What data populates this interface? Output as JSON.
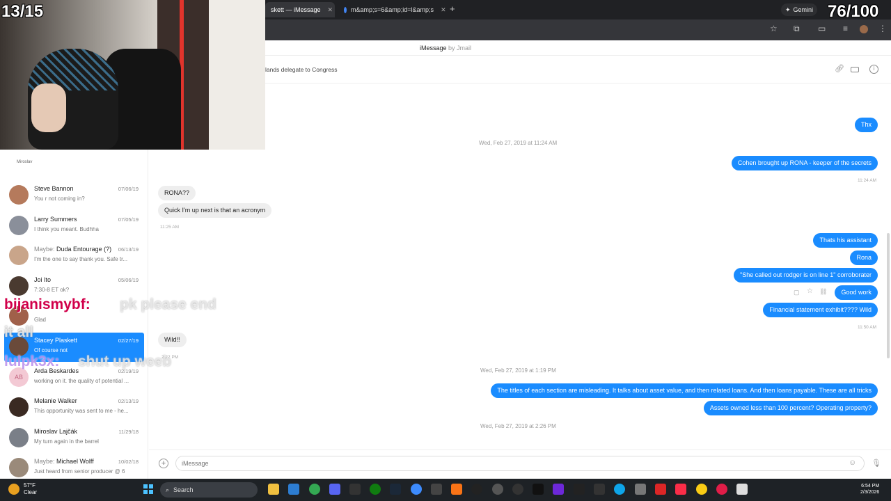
{
  "browser": {
    "tabs": [
      {
        "label": "skett — iMessage",
        "active": true
      },
      {
        "label": "m&amp;s=6&amp;id=l&amp;s",
        "active": false
      }
    ],
    "new_tab": "+",
    "gemini_label": "Gemini"
  },
  "app": {
    "title": "iMessage",
    "by": "by Jmail"
  },
  "chat": {
    "title": "lands delegate to Congress",
    "timestamps": [
      "Wed, Feb 27, 2019 at 11:24 AM",
      "Wed, Feb 27, 2019 at 1:19 PM",
      "Wed, Feb 27, 2019 at 2:26 PM"
    ],
    "times": [
      "11:24 AM",
      "11:25 AM",
      "11:50 AM",
      "2:22 PM"
    ],
    "messages": [
      "Thx",
      "Cohen brought up RONA - keeper of the secrets",
      "RONA??",
      "Quick I'm up next is that an acronym",
      "Thats his assistant",
      "Rona",
      "\"She called out rodger is on line 1\" corroborater",
      "Good work",
      "Financial statement exhibit???? Wild",
      "Wild!!",
      "The titles of each section are misleading. It talks about asset value, and then related loans. And then loans payable. These are all tricks",
      "Assets owned less than 100 percent? Operating property?"
    ],
    "composer_placeholder": "iMessage"
  },
  "sidebar": {
    "top_label": "Miroslav",
    "conversations": [
      {
        "maybe": "",
        "name": "Steve Bannon",
        "date": "07/06/19",
        "preview": "You r not coming in?"
      },
      {
        "maybe": "",
        "name": "Larry Summers",
        "date": "07/05/19",
        "preview": "I think you meant. Budhha"
      },
      {
        "maybe": "Maybe:",
        "name": "Duda Entourage (?)",
        "date": "06/13/19",
        "preview": "I'm the one to say thank you. Safe tr..."
      },
      {
        "maybe": "",
        "name": "Joi Ito",
        "date": "05/06/19",
        "preview": "7:30-8 ET ok?"
      },
      {
        "maybe": "",
        "name": "",
        "date": "",
        "preview": "Glad"
      },
      {
        "maybe": "",
        "name": "Stacey Plaskett",
        "date": "02/27/19",
        "preview": "Of course not"
      },
      {
        "maybe": "",
        "name": "Arda Beskardes",
        "date": "02/19/19",
        "preview": "working on it. the quality of potential ..."
      },
      {
        "maybe": "",
        "name": "Melanie Walker",
        "date": "02/13/19",
        "preview": "This opportunity was sent to me - he..."
      },
      {
        "maybe": "",
        "name": "Miroslav Lajčák",
        "date": "11/29/18",
        "preview": "My turn again in the barrel"
      },
      {
        "maybe": "Maybe:",
        "name": "Michael Wolff",
        "date": "10/02/18",
        "preview": "Just heard from senior producer @ 6"
      }
    ]
  },
  "overlay": {
    "left_counter": "13/15",
    "right_counter": "76/100",
    "chat_user1": "bijanismybf:",
    "chat_msg1": "pk please end",
    "chat_user2": "lulpk3x:",
    "chat_msg2": "shut up weeb",
    "chat_frag": "it all"
  },
  "taskbar": {
    "temp": "57°F",
    "weather": "Clear",
    "search": "Search",
    "time": "6:54 PM",
    "date": "2/3/2026"
  },
  "colors": {
    "imessage_blue": "#1a8cff",
    "incoming_gray": "#eeeeee",
    "selected_row": "#1a8cff"
  }
}
